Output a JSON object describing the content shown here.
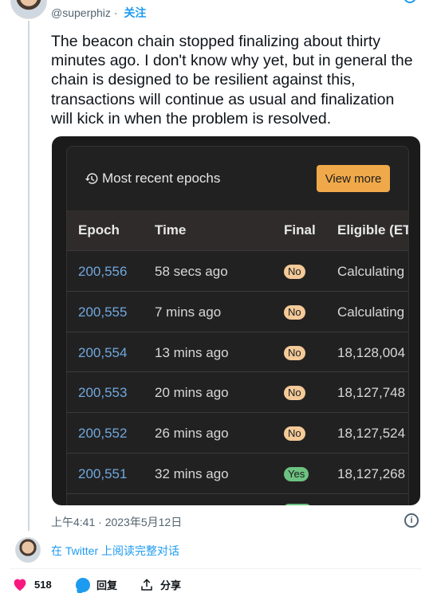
{
  "tweet": {
    "handle": "@superphiz",
    "separator": "·",
    "follow_label": "关注",
    "text": "The beacon chain stopped finalizing about thirty minutes ago. I don't know why yet, but in general the chain is designed to be resilient against this, transactions will continue as usual and finalization will kick in when the problem is resolved.",
    "timestamp": "上午4:41 · 2023年5月12日",
    "read_thread_label": "在 Twitter 上阅读完整对话"
  },
  "media": {
    "title": "Most recent epochs",
    "title_icon": "history-icon",
    "view_more_label": "View more",
    "columns": [
      "Epoch",
      "Time",
      "Final",
      "Eligible (ET"
    ],
    "rows": [
      {
        "epoch": "200,556",
        "time": "58 secs ago",
        "final": "No",
        "eligible": "Calculating"
      },
      {
        "epoch": "200,555",
        "time": "7 mins ago",
        "final": "No",
        "eligible": "Calculating"
      },
      {
        "epoch": "200,554",
        "time": "13 mins ago",
        "final": "No",
        "eligible": "18,128,004"
      },
      {
        "epoch": "200,553",
        "time": "20 mins ago",
        "final": "No",
        "eligible": "18,127,748"
      },
      {
        "epoch": "200,552",
        "time": "26 mins ago",
        "final": "No",
        "eligible": "18,127,524"
      },
      {
        "epoch": "200,551",
        "time": "32 mins ago",
        "final": "Yes",
        "eligible": "18,127,268"
      }
    ]
  },
  "actions": {
    "like_count": "518",
    "reply_label": "回复",
    "share_label": "分享"
  },
  "colors": {
    "accent": "#1d9bf0",
    "like": "#f91880",
    "view_more_bg": "#f0a94a",
    "badge_no": "#f3ca98",
    "badge_yes": "#6cc280",
    "epoch_link": "#6fa8dc"
  }
}
